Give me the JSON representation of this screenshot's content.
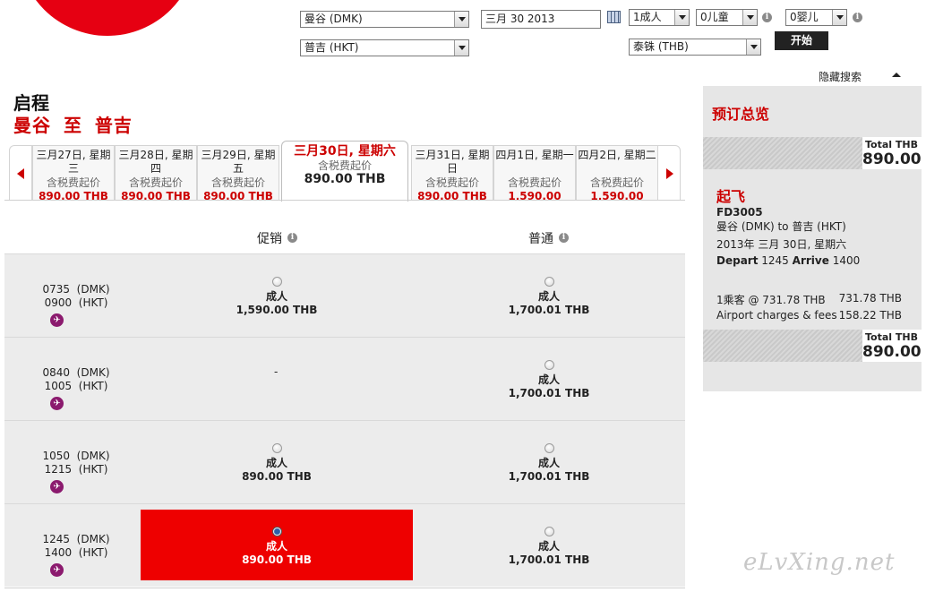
{
  "search": {
    "from": "曼谷 (DMK)",
    "to": "普吉 (HKT)",
    "date": "三月 30 2013",
    "adults": "1成人",
    "children": "0儿童",
    "infants": "0婴儿",
    "currency": "泰铢 (THB)",
    "go_label": "开始",
    "hide_label": "隐藏搜索"
  },
  "trip": {
    "title": "启程",
    "route": "曼谷 至 普吉"
  },
  "date_tabs": [
    {
      "date": "三月27日, 星期三",
      "label": "含税费起价",
      "price": "890.00 THB"
    },
    {
      "date": "三月28日, 星期四",
      "label": "含税费起价",
      "price": "890.00 THB"
    },
    {
      "date": "三月29日, 星期五",
      "label": "含税费起价",
      "price": "890.00 THB"
    },
    {
      "date": "三月30日, 星期六",
      "label": "含税费起价",
      "price": "890.00 THB"
    },
    {
      "date": "三月31日, 星期日",
      "label": "含税费起价",
      "price": "890.00 THB"
    },
    {
      "date": "四月1日, 星期一",
      "label": "含税费起价",
      "price": "1,590.00 THB"
    },
    {
      "date": "四月2日, 星期二",
      "label": "含税费起价",
      "price": "1,590.00 THB"
    }
  ],
  "columns": {
    "promo": "促销",
    "regular": "普通"
  },
  "flights": [
    {
      "dep": "0735",
      "dep_code": "(DMK)",
      "arr": "0900",
      "arr_code": "(HKT)",
      "promo_type": "成人",
      "promo_price": "1,590.00 THB",
      "regular_type": "成人",
      "regular_price": "1,700.01 THB"
    },
    {
      "dep": "0840",
      "dep_code": "(DMK)",
      "arr": "1005",
      "arr_code": "(HKT)",
      "promo_none": "-",
      "regular_type": "成人",
      "regular_price": "1,700.01 THB"
    },
    {
      "dep": "1050",
      "dep_code": "(DMK)",
      "arr": "1215",
      "arr_code": "(HKT)",
      "promo_type": "成人",
      "promo_price": "890.00 THB",
      "regular_type": "成人",
      "regular_price": "1,700.01 THB"
    },
    {
      "dep": "1245",
      "dep_code": "(DMK)",
      "arr": "1400",
      "arr_code": "(HKT)",
      "promo_type": "成人",
      "promo_price": "890.00 THB",
      "regular_type": "成人",
      "regular_price": "1,700.01 THB"
    }
  ],
  "summary": {
    "title": "预订总览",
    "total_label": "Total THB",
    "total": "890.00",
    "depart_heading": "起飞",
    "flight_no": "FD3005",
    "route": "曼谷 (DMK) to 普吉 (HKT)",
    "date": "2013年 三月 30日, 星期六",
    "depart_word": "Depart",
    "depart_time": "1245",
    "arrive_word": "Arrive",
    "arrive_time": "1400",
    "pax_line": "1乘客 @ 731.78 THB",
    "pax_amount": "731.78 THB",
    "charges_line": "Airport charges & fees",
    "charges_amount": "158.22 THB",
    "total_label_2": "Total THB",
    "total_2": "890.00"
  },
  "watermark": "eLvXing.net",
  "colors": {
    "brand": "#e60012",
    "selected": "#e00000",
    "panel": "#e6e6e6"
  }
}
